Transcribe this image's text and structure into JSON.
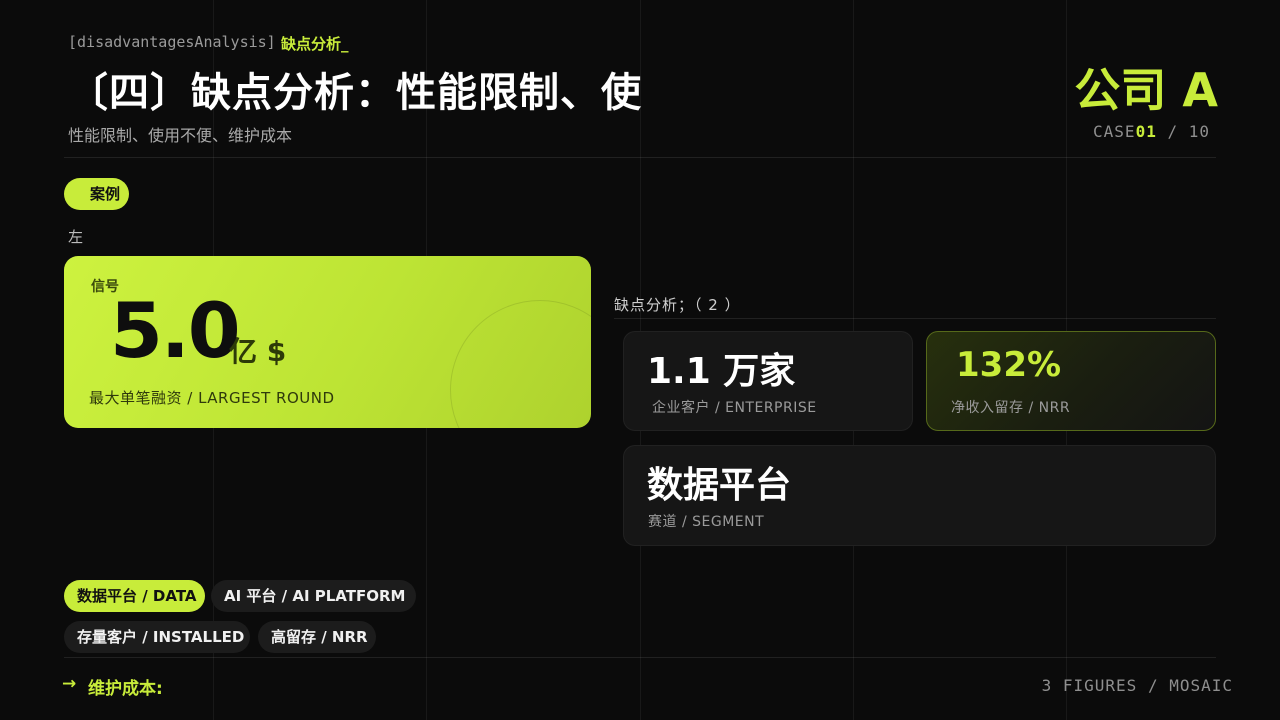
{
  "header": {
    "code_tag": "[disadvantagesAnalysis]",
    "accent_tag": "缺点分析_",
    "title": "〔四〕缺点分析：性能限制、使",
    "subtitle": "性能限制、使用不便、维护成本",
    "company": "公司 A",
    "case_prefix": "CASE",
    "case_number": "01",
    "case_total": " / 10"
  },
  "chip": {
    "label": "案例"
  },
  "left_label": "左",
  "hero": {
    "label": "信号",
    "value": "5.0",
    "unit": "亿 $",
    "desc": "最大单笔融资 / LARGEST ROUND"
  },
  "section": {
    "label": "缺点分析；（ 2 ）"
  },
  "stats": [
    {
      "value": "1.1 万家",
      "desc": "企业客户 / ENTERPRISE"
    },
    {
      "value": "132%",
      "desc": "净收入留存 / NRR"
    },
    {
      "value": "数据平台",
      "desc": "赛道 / SEGMENT"
    }
  ],
  "tags": [
    {
      "label": "数据平台 / DATA"
    },
    {
      "label": "AI 平台 / AI PLATFORM"
    },
    {
      "label": "存量客户 / INSTALLED"
    },
    {
      "label": "高留存 / NRR"
    }
  ],
  "footer": {
    "arrow": "→",
    "text": "维护成本:",
    "right": "3 FIGURES / MOSAIC"
  },
  "colors": {
    "accent": "#c8ec3a",
    "background": "#0b0b0b",
    "card": "#161616"
  }
}
